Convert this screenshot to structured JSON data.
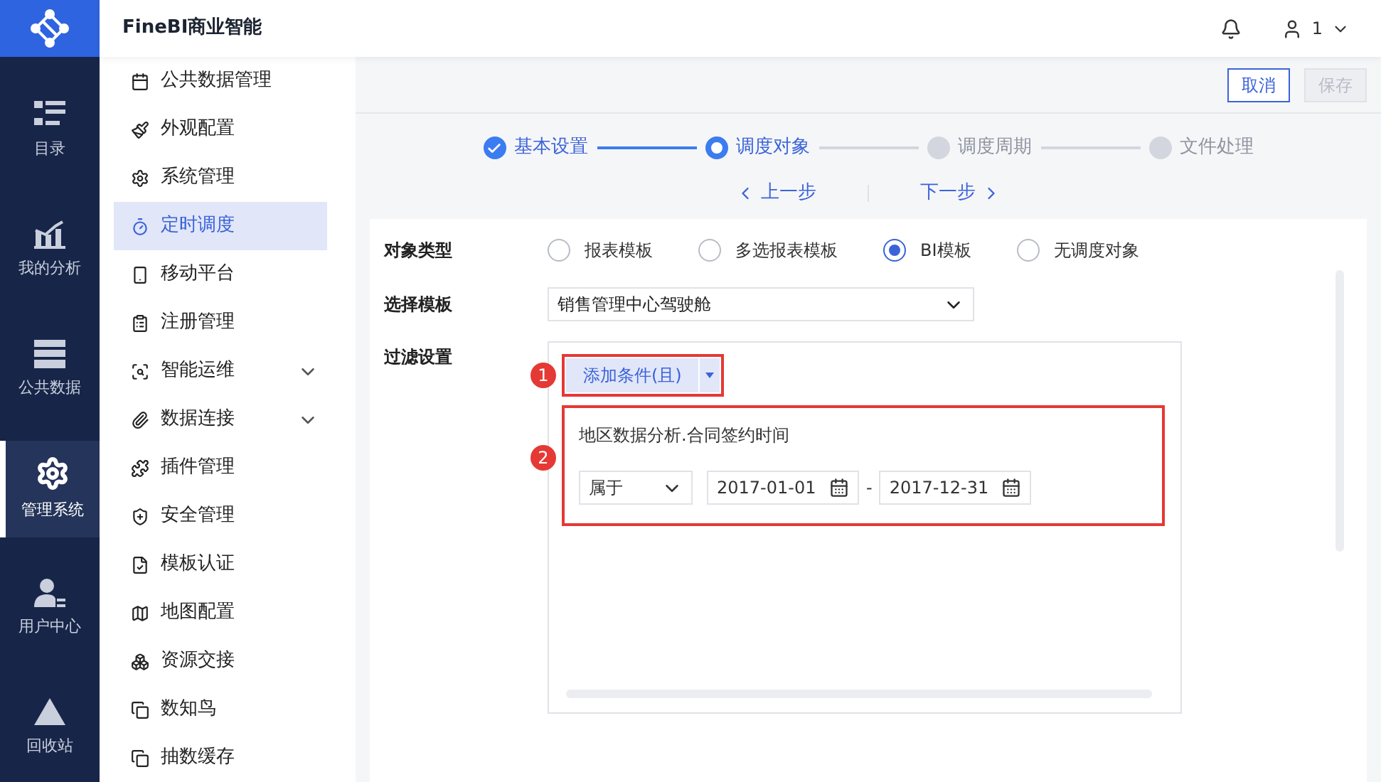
{
  "app": {
    "title": "FineBI商业智能"
  },
  "header": {
    "user": "1"
  },
  "rail": [
    {
      "label": "目录",
      "selected": false
    },
    {
      "label": "我的分析",
      "selected": false
    },
    {
      "label": "公共数据",
      "selected": false
    },
    {
      "label": "管理系统",
      "selected": true
    },
    {
      "label": "用户中心",
      "selected": false
    },
    {
      "label": "回收站",
      "selected": false
    }
  ],
  "sidebar": {
    "items": [
      {
        "label": "公共数据管理",
        "selected": false,
        "expandable": false
      },
      {
        "label": "外观配置",
        "selected": false,
        "expandable": false
      },
      {
        "label": "系统管理",
        "selected": false,
        "expandable": false
      },
      {
        "label": "定时调度",
        "selected": true,
        "expandable": false
      },
      {
        "label": "移动平台",
        "selected": false,
        "expandable": false
      },
      {
        "label": "注册管理",
        "selected": false,
        "expandable": false
      },
      {
        "label": "智能运维",
        "selected": false,
        "expandable": true
      },
      {
        "label": "数据连接",
        "selected": false,
        "expandable": true
      },
      {
        "label": "插件管理",
        "selected": false,
        "expandable": false
      },
      {
        "label": "安全管理",
        "selected": false,
        "expandable": false
      },
      {
        "label": "模板认证",
        "selected": false,
        "expandable": false
      },
      {
        "label": "地图配置",
        "selected": false,
        "expandable": false
      },
      {
        "label": "资源交接",
        "selected": false,
        "expandable": false
      },
      {
        "label": "数知鸟",
        "selected": false,
        "expandable": false
      },
      {
        "label": "抽数缓存",
        "selected": false,
        "expandable": false
      }
    ]
  },
  "actions": [
    {
      "label": "取消",
      "disabled": false
    },
    {
      "label": "保存",
      "disabled": true
    }
  ],
  "steps": [
    {
      "label": "基本设置",
      "kind": "done"
    },
    {
      "label": "调度对象",
      "kind": "current"
    },
    {
      "label": "调度周期",
      "kind": "pending"
    },
    {
      "label": "文件处理",
      "kind": "pending"
    }
  ],
  "step_nav": {
    "prev": "上一步",
    "next": "下一步"
  },
  "form": {
    "type_label": "对象类型",
    "types": [
      {
        "label": "报表模板",
        "selected": false
      },
      {
        "label": "多选报表模板",
        "selected": false
      },
      {
        "label": "BI模板",
        "selected": true
      },
      {
        "label": "无调度对象",
        "selected": false
      }
    ],
    "template_label": "选择模板",
    "template_value": "销售管理中心驾驶舱",
    "filter_label": "过滤设置",
    "add_condition": "添加条件(且)",
    "condition": {
      "field": "地区数据分析.合同签约时间",
      "operator": "属于",
      "start": "2017-01-01",
      "separator": "-",
      "end": "2017-12-31"
    }
  },
  "annotations": [
    {
      "label": "1"
    },
    {
      "label": "2"
    }
  ]
}
